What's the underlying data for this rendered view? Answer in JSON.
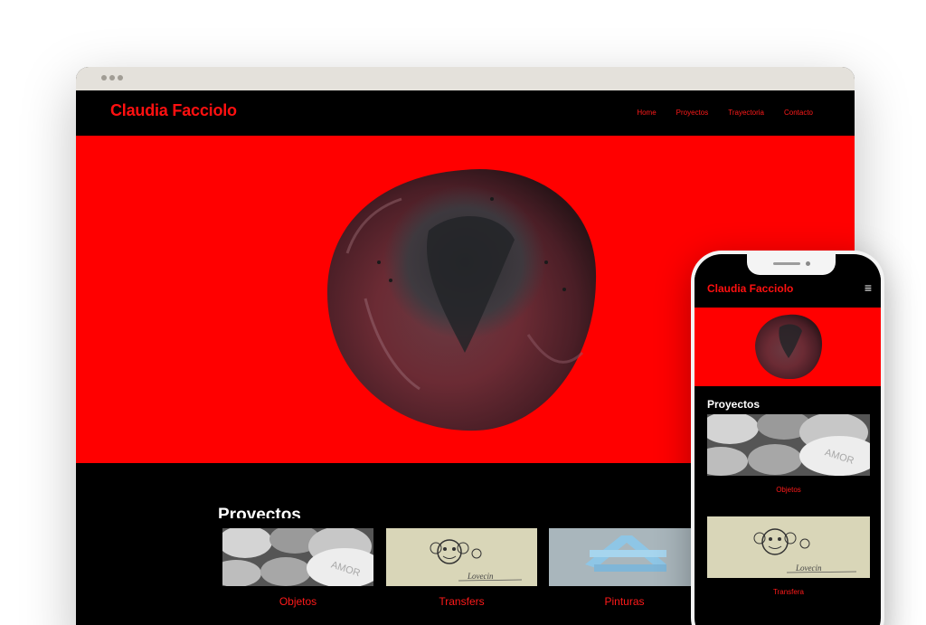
{
  "site": {
    "logo": "Claudia Facciolo",
    "nav": [
      "Home",
      "Proyectos",
      "Trayectoria",
      "Contacto"
    ]
  },
  "projects": {
    "title": "Proyectos",
    "items": [
      {
        "label": "Objetos"
      },
      {
        "label": "Transfers"
      },
      {
        "label": "Pinturas"
      }
    ]
  },
  "mobile": {
    "logo": "Claudia Facciolo",
    "menu_icon": "≡",
    "projects_title": "Proyectos",
    "items": [
      {
        "label": "Objetos"
      },
      {
        "label": "Transfera"
      }
    ]
  },
  "image_texts": {
    "pill_text": "AMOR",
    "signature": "Lovecin"
  },
  "colors": {
    "accent": "#ff1010",
    "hero_background": "#ff0000",
    "page_background": "#000000",
    "chrome": "#e4e1db"
  }
}
